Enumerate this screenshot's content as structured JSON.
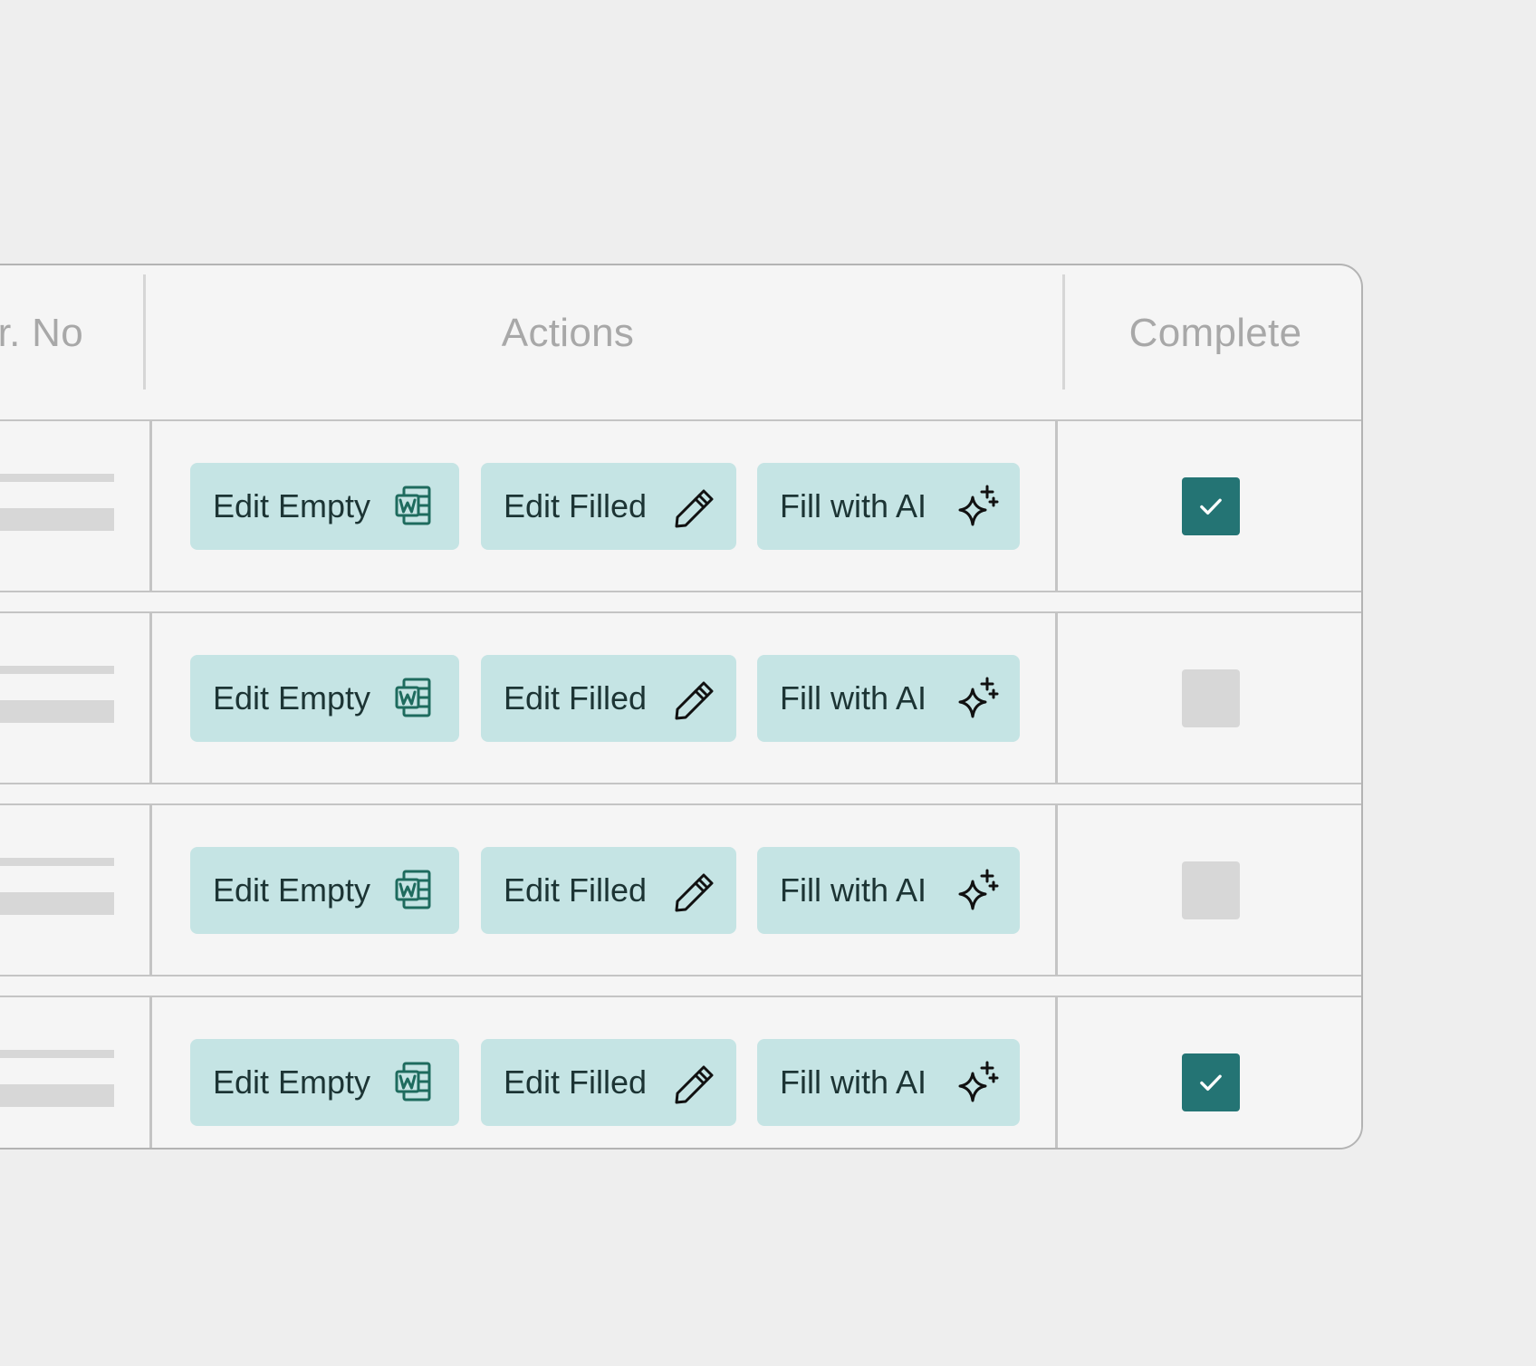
{
  "table": {
    "headers": {
      "sr_no": "r. No",
      "actions": "Actions",
      "complete": "Complete"
    },
    "rows": [
      {
        "edit_empty": "Edit Empty",
        "edit_filled": "Edit Filled",
        "fill_ai": "Fill with AI",
        "complete": true
      },
      {
        "edit_empty": "Edit Empty",
        "edit_filled": "Edit Filled",
        "fill_ai": "Fill with AI",
        "complete": false
      },
      {
        "edit_empty": "Edit Empty",
        "edit_filled": "Edit Filled",
        "fill_ai": "Fill with AI",
        "complete": false
      },
      {
        "edit_empty": "Edit Empty",
        "edit_filled": "Edit Filled",
        "fill_ai": "Fill with AI",
        "complete": true
      }
    ]
  },
  "icons": {
    "edit_empty": "word-document-icon",
    "edit_filled": "pencil-icon",
    "fill_ai": "sparkles-icon",
    "complete": "checkmark-icon"
  },
  "colors": {
    "button_bg": "#c5e4e4",
    "checkbox_checked": "#247474",
    "checkbox_unchecked": "#d7d7d7",
    "card_bg": "#f5f5f5",
    "page_bg": "#eeeeee"
  }
}
